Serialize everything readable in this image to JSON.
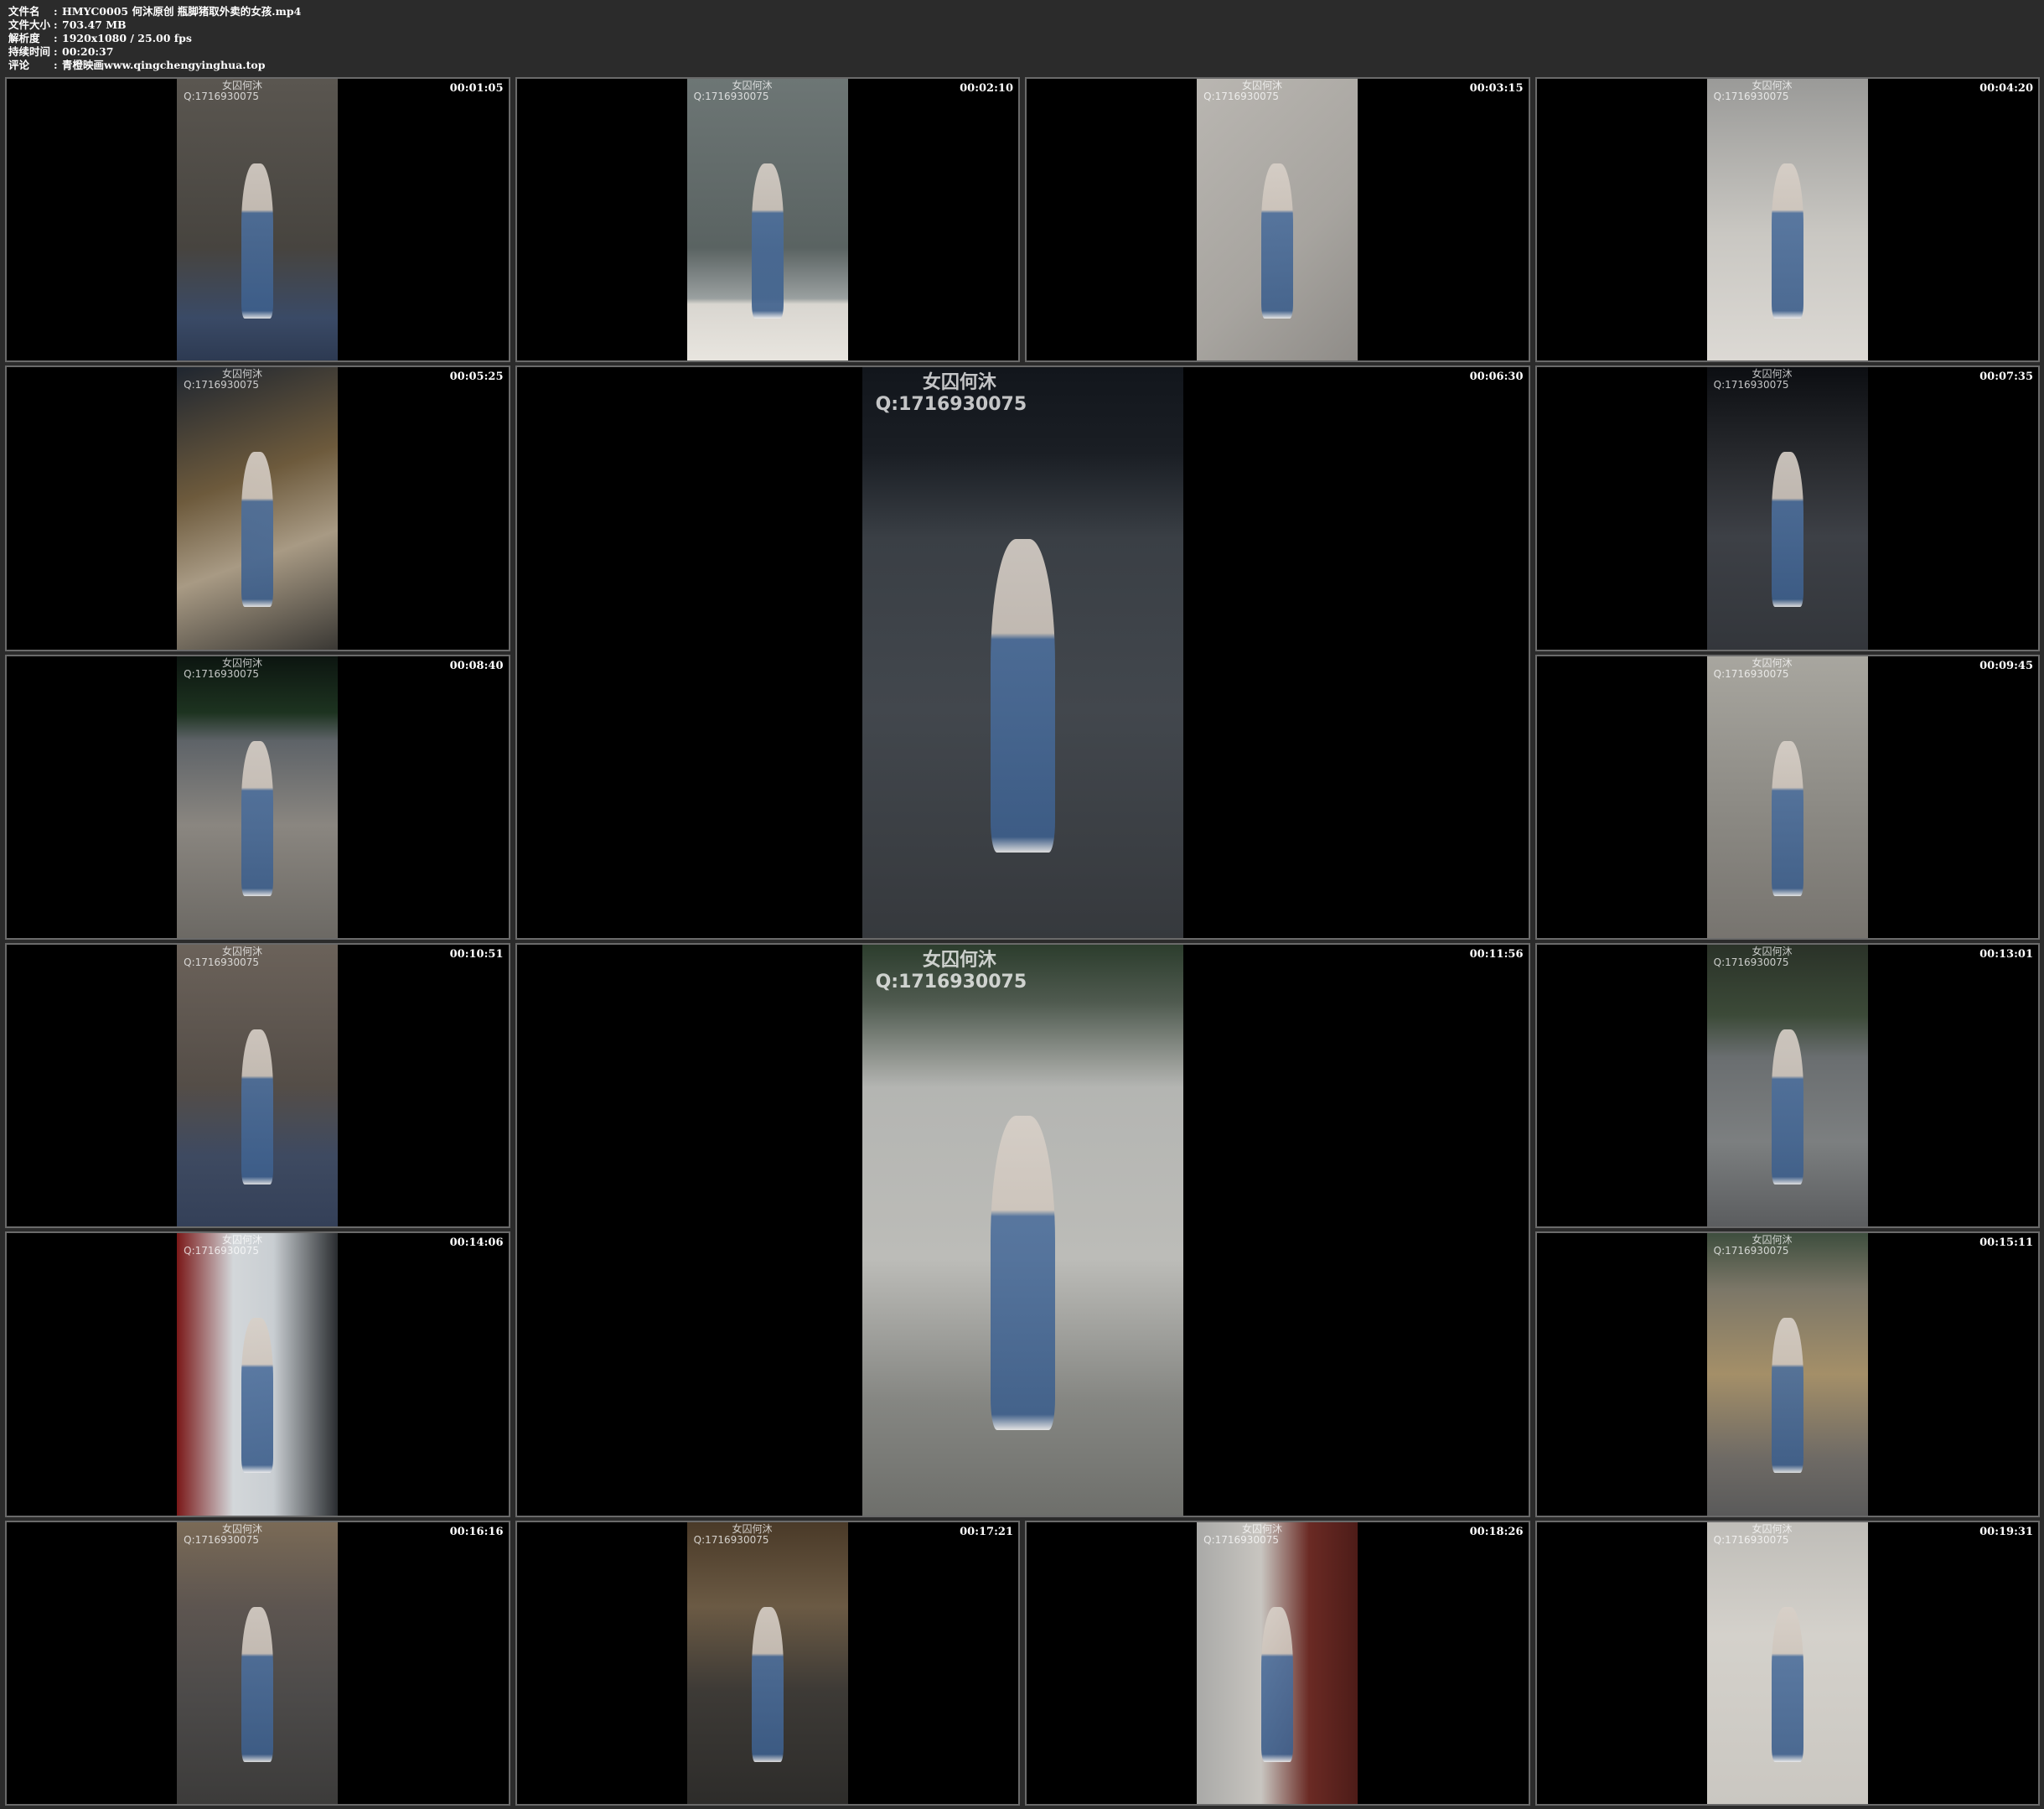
{
  "header": {
    "rows": [
      {
        "label": "文件名",
        "value": "HMYC0005 何沐原创 瓶脚猪取外卖的女孩.mp4"
      },
      {
        "label": "文件大小",
        "value": "703.47 MB"
      },
      {
        "label": "解析度",
        "value": "1920x1080 / 25.00 fps"
      },
      {
        "label": "持续时间",
        "value": "00:20:37"
      },
      {
        "label": "评论",
        "value": "青橙映画www.qingchengyinghua.top"
      }
    ]
  },
  "watermark": {
    "name": "女囚何沐",
    "qq": "Q:1716930075"
  },
  "tiles": [
    {
      "time": "00:01:05",
      "bg": "linear-gradient(#5a5650, #47443f 60%, #3a4a66 85%, #2d3a52)"
    },
    {
      "time": "00:02:10",
      "bg": "linear-gradient(#6d7675 0%, #5a6362 60%, #9aa0a0 78%, #d9d6d0 80%, #e8e5df)"
    },
    {
      "time": "00:03:15",
      "bg": "linear-gradient(135deg, #b9b6b1, #a7a49f 60%, #8f8c88)"
    },
    {
      "time": "00:04:20",
      "bg": "linear-gradient(#9a9a98, #c9c7c2 55%, #dcd9d4)"
    },
    {
      "time": "00:05:25",
      "bg": "linear-gradient(160deg, #1f2630, #6d5a3c 40%, #a89a84 65%, #3a3834)"
    },
    {
      "time": "00:06:30",
      "bg": "linear-gradient(#12161c 0%, #1a1e24 15%, #3a3f45 30%, #42474d 60%, #36393d)"
    },
    {
      "time": "00:07:35",
      "bg": "linear-gradient(#0c0e12, #2a2c30 35%, #3d4046 60%, #33363b)"
    },
    {
      "time": "00:08:40",
      "bg": "linear-gradient(#0c1510 0%, #1d3320 20%, #5e6368 30%, #8a8680 60%, #6c6964)"
    },
    {
      "time": "00:09:45",
      "bg": "linear-gradient(#a8a69f, #8e8c86 50%, #77746f)"
    },
    {
      "time": "00:10:51",
      "bg": "linear-gradient(#6b625a, #544d47 50%, #3e4a61 75%, #344058)"
    },
    {
      "time": "00:11:56",
      "bg": "linear-gradient(#2c3d2d 0%, #4f5a4f 10%, #b4b5b2 25%, #bcbcb8 55%, #858682 80%, #6e6f6b)"
    },
    {
      "time": "00:13:01",
      "bg": "linear-gradient(#2a3228 0%, #3c4a38 25%, #6a6e70 40%, #7c7f80 70%, #5b5d5f)"
    },
    {
      "time": "00:14:06",
      "bg": "linear-gradient(90deg, #7a1818 0%, #d3d7da 35%, #c9ced2 60%, #2a2d30 100%)"
    },
    {
      "time": "00:15:11",
      "bg": "linear-gradient(#3e4e3e 0%, #7c7768 20%, #a48f68 50%, #6e6a65 80%, #5a5a5a)"
    },
    {
      "time": "00:16:16",
      "bg": "linear-gradient(#7a6a56 0%, #5d5550 30%, #4d4b4a 60%, #3c3b3a)"
    },
    {
      "time": "00:17:21",
      "bg": "linear-gradient(#4a3a28 0%, #6b5a44 30%, #3d3a36 60%, #2d2c2a)"
    },
    {
      "time": "00:18:26",
      "bg": "linear-gradient(90deg, #a9a9a7 0%, #c8c5c0 40%, #6a2a24 70%, #4d1c18 100%)"
    },
    {
      "time": "00:19:31",
      "bg": "linear-gradient(#bfbdb8, #d4d1cb 40%, #cac7c1)"
    }
  ]
}
